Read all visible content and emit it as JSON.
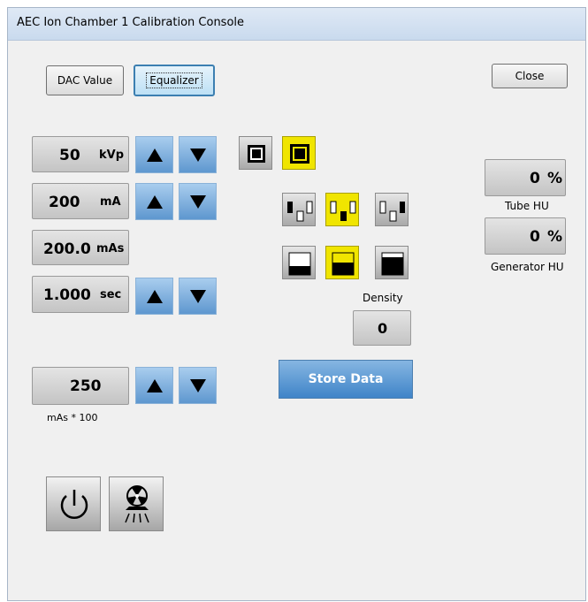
{
  "window": {
    "title": "AEC Ion Chamber 1 Calibration Console"
  },
  "toolbar": {
    "dac_value_label": "DAC Value",
    "equalizer_label": "Equalizer",
    "close_label": "Close"
  },
  "settings": {
    "kvp": {
      "value": "50",
      "unit": "kVp"
    },
    "ma": {
      "value": "200",
      "unit": "mA"
    },
    "mas": {
      "value": "200.0",
      "unit": "mAs"
    },
    "time": {
      "value": "1.000",
      "unit": "sec"
    },
    "mas100": {
      "value": "250",
      "caption": "mAs * 100"
    }
  },
  "density": {
    "label": "Density",
    "value": "0"
  },
  "store_label": "Store Data",
  "heat_units": {
    "tube": {
      "value": "0",
      "unit": "%",
      "label": "Tube HU"
    },
    "generator": {
      "value": "0",
      "unit": "%",
      "label": "Generator HU"
    }
  },
  "icons": {
    "arrow_up": "triangle-up-icon",
    "arrow_down": "triangle-down-icon",
    "power": "power-icon",
    "exposure": "radiation-exposure-icon"
  },
  "colors": {
    "selected": "#f0e500",
    "arrow_blue": "#5e97cf",
    "store_blue": "#3f84c8"
  }
}
